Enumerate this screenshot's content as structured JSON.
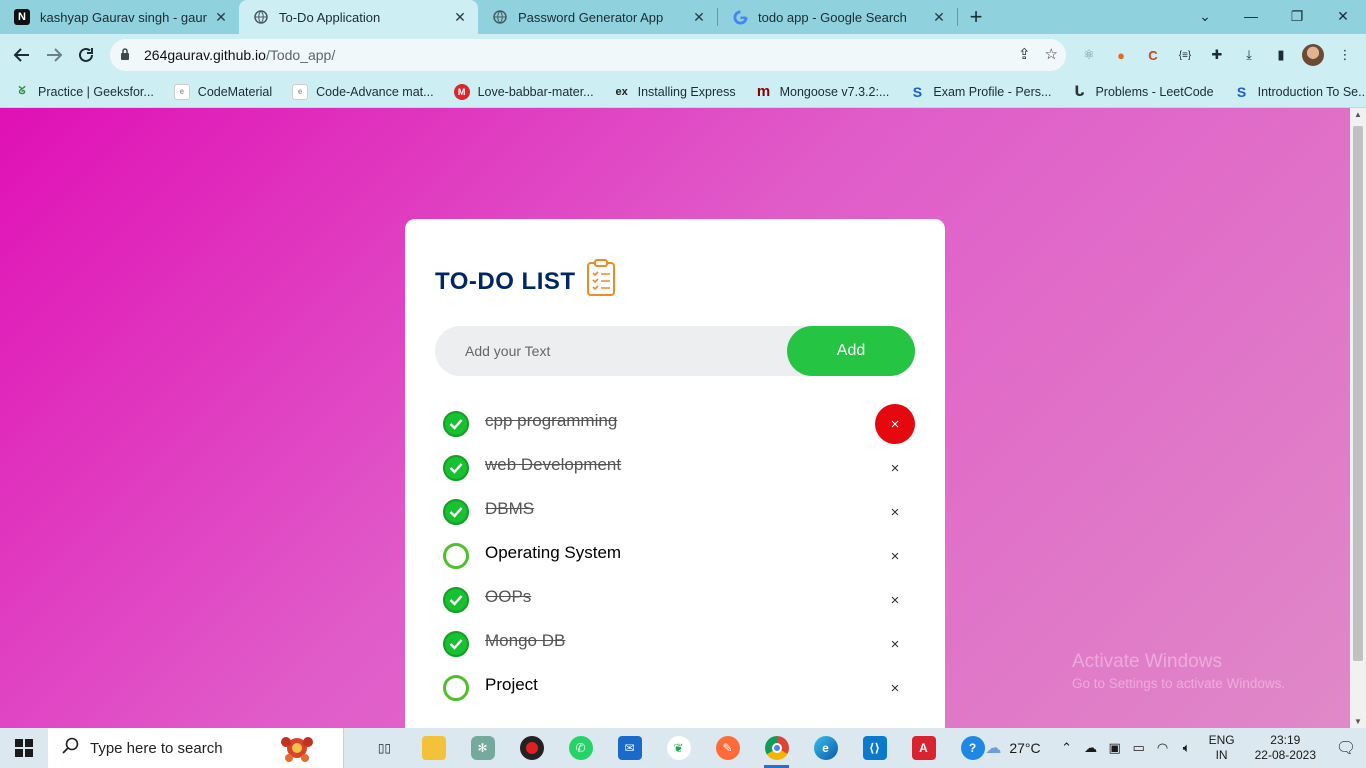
{
  "browser": {
    "tabs": [
      {
        "title": "kashyap Gaurav singh - gauravsi",
        "favicon": "gfg-n-icon"
      },
      {
        "title": "To-Do Application",
        "favicon": "globe-icon"
      },
      {
        "title": "Password Generator App",
        "favicon": "globe-icon"
      },
      {
        "title": "todo app - Google Search",
        "favicon": "google-icon"
      }
    ],
    "url_host": "264gaurav.github.io",
    "url_path": "/Todo_app/",
    "bookmarks": [
      {
        "label": "Practice | Geeksfor...",
        "icon": "gfg-icon"
      },
      {
        "label": "CodeMaterial",
        "icon": "doc-icon"
      },
      {
        "label": "Code-Advance mat...",
        "icon": "doc-icon"
      },
      {
        "label": "Love-babbar-mater...",
        "icon": "mega-icon"
      },
      {
        "label": "Installing Express",
        "icon": "express-icon"
      },
      {
        "label": "Mongoose v7.3.2:...",
        "icon": "mongoose-icon"
      },
      {
        "label": "Exam Profile - Pers...",
        "icon": "s-icon"
      },
      {
        "label": "Problems - LeetCode",
        "icon": "leetcode-icon"
      },
      {
        "label": "Introduction To Se...",
        "icon": "s-icon"
      }
    ]
  },
  "app": {
    "title": "TO-DO LIST",
    "input_placeholder": "Add your Text",
    "add_label": "Add",
    "items": [
      {
        "text": "cpp programming",
        "done": true
      },
      {
        "text": "web Development",
        "done": true
      },
      {
        "text": "DBMS",
        "done": true
      },
      {
        "text": "Operating System",
        "done": false
      },
      {
        "text": "OOPs",
        "done": true
      },
      {
        "text": "Mongo DB",
        "done": true
      },
      {
        "text": "Project",
        "done": false
      }
    ],
    "delete_glyph": "×"
  },
  "watermark": {
    "line1": "Activate Windows",
    "line2": "Go to Settings to activate Windows."
  },
  "taskbar": {
    "search_placeholder": "Type here to search",
    "weather": "27°C",
    "lang_1": "ENG",
    "lang_2": "IN",
    "time": "23:19",
    "date": "22-08-2023"
  }
}
